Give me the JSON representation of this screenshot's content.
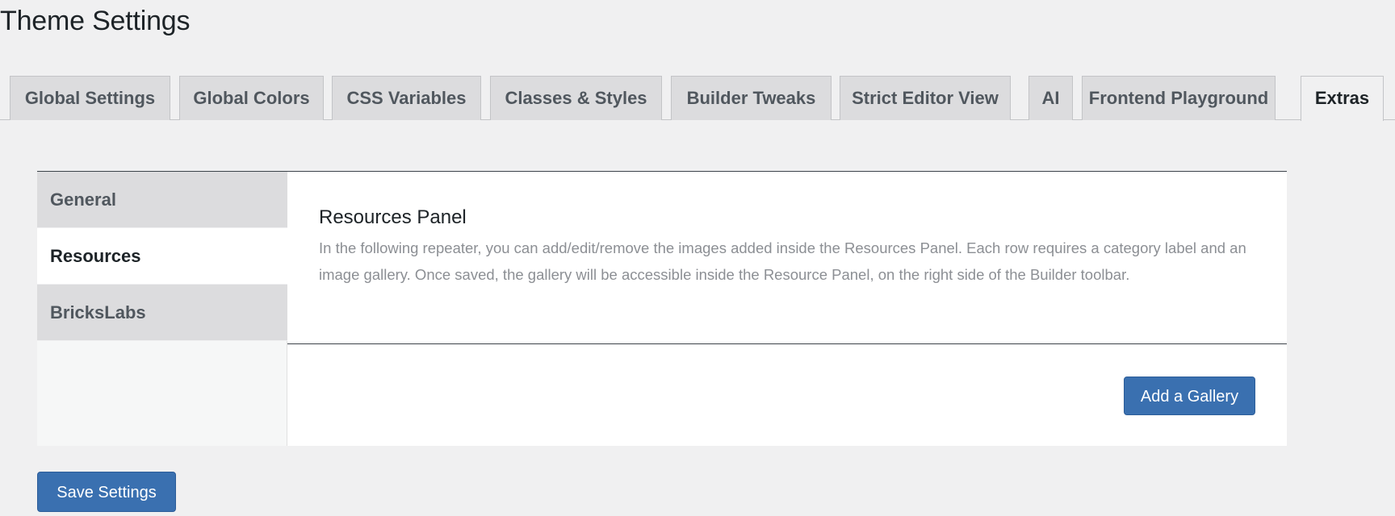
{
  "page": {
    "title": "Theme Settings"
  },
  "tabs": [
    {
      "label": "Global Settings",
      "active": false
    },
    {
      "label": "Global Colors",
      "active": false
    },
    {
      "label": "CSS Variables",
      "active": false
    },
    {
      "label": "Classes & Styles",
      "active": false
    },
    {
      "label": "Builder Tweaks",
      "active": false
    },
    {
      "label": "Strict Editor View",
      "active": false
    },
    {
      "label": "AI",
      "active": false
    },
    {
      "label": "Frontend Playground",
      "active": false
    },
    {
      "label": "Extras",
      "active": true
    }
  ],
  "sidebar": {
    "items": [
      {
        "label": "General",
        "active": false
      },
      {
        "label": "Resources",
        "active": true
      },
      {
        "label": "BricksLabs",
        "active": false
      }
    ]
  },
  "section": {
    "title": "Resources Panel",
    "description": "In the following repeater, you can add/edit/remove the images added inside the Resources Panel. Each row requires a category label and an image gallery. Once saved, the gallery will be accessible inside the Resource Panel, on the right side of the Builder toolbar.",
    "add_button_label": "Add a Gallery"
  },
  "footer": {
    "save_label": "Save Settings"
  },
  "colors": {
    "primary_button": "#3a70b0",
    "tab_inactive": "#dcdcde",
    "page_background": "#f0f0f1"
  }
}
